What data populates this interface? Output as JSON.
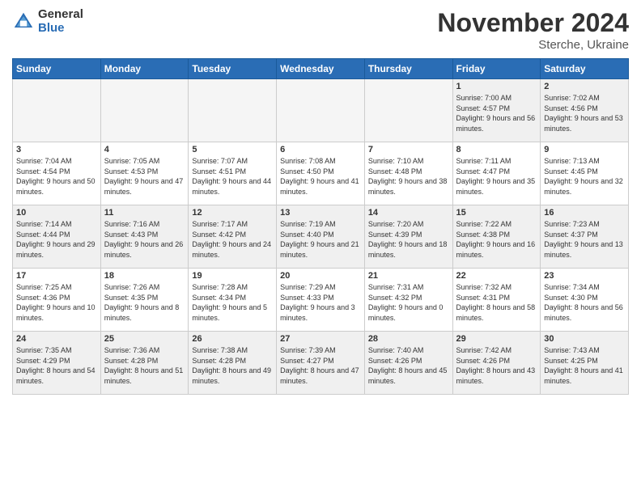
{
  "logo": {
    "general": "General",
    "blue": "Blue"
  },
  "title": "November 2024",
  "location": "Sterche, Ukraine",
  "days_header": [
    "Sunday",
    "Monday",
    "Tuesday",
    "Wednesday",
    "Thursday",
    "Friday",
    "Saturday"
  ],
  "weeks": [
    [
      {
        "day": "",
        "info": ""
      },
      {
        "day": "",
        "info": ""
      },
      {
        "day": "",
        "info": ""
      },
      {
        "day": "",
        "info": ""
      },
      {
        "day": "",
        "info": ""
      },
      {
        "day": "1",
        "info": "Sunrise: 7:00 AM\nSunset: 4:57 PM\nDaylight: 9 hours and 56 minutes."
      },
      {
        "day": "2",
        "info": "Sunrise: 7:02 AM\nSunset: 4:56 PM\nDaylight: 9 hours and 53 minutes."
      }
    ],
    [
      {
        "day": "3",
        "info": "Sunrise: 7:04 AM\nSunset: 4:54 PM\nDaylight: 9 hours and 50 minutes."
      },
      {
        "day": "4",
        "info": "Sunrise: 7:05 AM\nSunset: 4:53 PM\nDaylight: 9 hours and 47 minutes."
      },
      {
        "day": "5",
        "info": "Sunrise: 7:07 AM\nSunset: 4:51 PM\nDaylight: 9 hours and 44 minutes."
      },
      {
        "day": "6",
        "info": "Sunrise: 7:08 AM\nSunset: 4:50 PM\nDaylight: 9 hours and 41 minutes."
      },
      {
        "day": "7",
        "info": "Sunrise: 7:10 AM\nSunset: 4:48 PM\nDaylight: 9 hours and 38 minutes."
      },
      {
        "day": "8",
        "info": "Sunrise: 7:11 AM\nSunset: 4:47 PM\nDaylight: 9 hours and 35 minutes."
      },
      {
        "day": "9",
        "info": "Sunrise: 7:13 AM\nSunset: 4:45 PM\nDaylight: 9 hours and 32 minutes."
      }
    ],
    [
      {
        "day": "10",
        "info": "Sunrise: 7:14 AM\nSunset: 4:44 PM\nDaylight: 9 hours and 29 minutes."
      },
      {
        "day": "11",
        "info": "Sunrise: 7:16 AM\nSunset: 4:43 PM\nDaylight: 9 hours and 26 minutes."
      },
      {
        "day": "12",
        "info": "Sunrise: 7:17 AM\nSunset: 4:42 PM\nDaylight: 9 hours and 24 minutes."
      },
      {
        "day": "13",
        "info": "Sunrise: 7:19 AM\nSunset: 4:40 PM\nDaylight: 9 hours and 21 minutes."
      },
      {
        "day": "14",
        "info": "Sunrise: 7:20 AM\nSunset: 4:39 PM\nDaylight: 9 hours and 18 minutes."
      },
      {
        "day": "15",
        "info": "Sunrise: 7:22 AM\nSunset: 4:38 PM\nDaylight: 9 hours and 16 minutes."
      },
      {
        "day": "16",
        "info": "Sunrise: 7:23 AM\nSunset: 4:37 PM\nDaylight: 9 hours and 13 minutes."
      }
    ],
    [
      {
        "day": "17",
        "info": "Sunrise: 7:25 AM\nSunset: 4:36 PM\nDaylight: 9 hours and 10 minutes."
      },
      {
        "day": "18",
        "info": "Sunrise: 7:26 AM\nSunset: 4:35 PM\nDaylight: 9 hours and 8 minutes."
      },
      {
        "day": "19",
        "info": "Sunrise: 7:28 AM\nSunset: 4:34 PM\nDaylight: 9 hours and 5 minutes."
      },
      {
        "day": "20",
        "info": "Sunrise: 7:29 AM\nSunset: 4:33 PM\nDaylight: 9 hours and 3 minutes."
      },
      {
        "day": "21",
        "info": "Sunrise: 7:31 AM\nSunset: 4:32 PM\nDaylight: 9 hours and 0 minutes."
      },
      {
        "day": "22",
        "info": "Sunrise: 7:32 AM\nSunset: 4:31 PM\nDaylight: 8 hours and 58 minutes."
      },
      {
        "day": "23",
        "info": "Sunrise: 7:34 AM\nSunset: 4:30 PM\nDaylight: 8 hours and 56 minutes."
      }
    ],
    [
      {
        "day": "24",
        "info": "Sunrise: 7:35 AM\nSunset: 4:29 PM\nDaylight: 8 hours and 54 minutes."
      },
      {
        "day": "25",
        "info": "Sunrise: 7:36 AM\nSunset: 4:28 PM\nDaylight: 8 hours and 51 minutes."
      },
      {
        "day": "26",
        "info": "Sunrise: 7:38 AM\nSunset: 4:28 PM\nDaylight: 8 hours and 49 minutes."
      },
      {
        "day": "27",
        "info": "Sunrise: 7:39 AM\nSunset: 4:27 PM\nDaylight: 8 hours and 47 minutes."
      },
      {
        "day": "28",
        "info": "Sunrise: 7:40 AM\nSunset: 4:26 PM\nDaylight: 8 hours and 45 minutes."
      },
      {
        "day": "29",
        "info": "Sunrise: 7:42 AM\nSunset: 4:26 PM\nDaylight: 8 hours and 43 minutes."
      },
      {
        "day": "30",
        "info": "Sunrise: 7:43 AM\nSunset: 4:25 PM\nDaylight: 8 hours and 41 minutes."
      }
    ]
  ]
}
